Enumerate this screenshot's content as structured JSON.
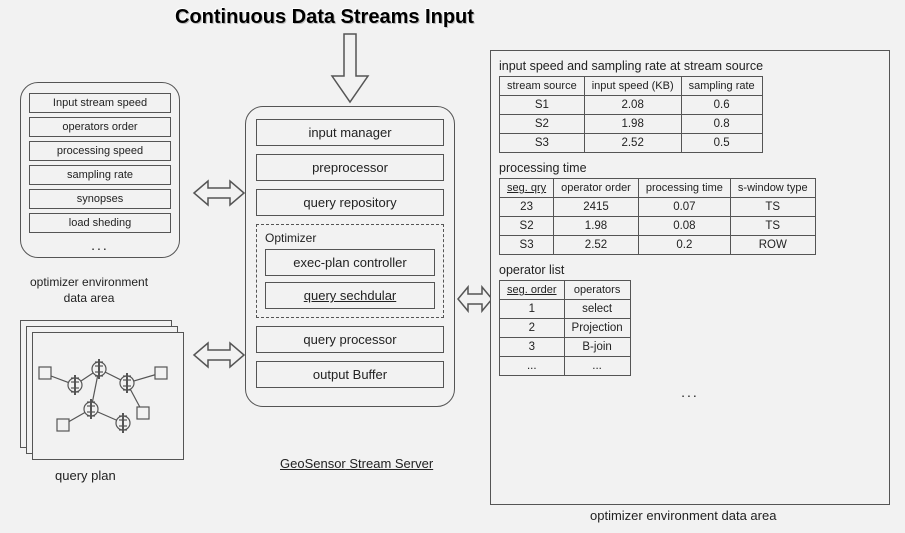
{
  "title": "Continuous Data Streams Input",
  "env_area": {
    "items": [
      "Input stream speed",
      "operators order",
      "processing speed",
      "sampling rate",
      "synopses",
      "load sheding"
    ],
    "dots": "...",
    "label_line1": "optimizer  environment",
    "label_line2": "data area"
  },
  "server": {
    "items_top": [
      "input manager",
      "preprocessor",
      "query repository"
    ],
    "optimizer_title": "Optimizer",
    "optimizer_items": [
      "exec-plan controller",
      "query sechdular"
    ],
    "items_bottom": [
      "query processor",
      "output Buffer"
    ],
    "label_prefix": "GeoSensor",
    "label_suffix": " Stream Server"
  },
  "query_plan_label": "query plan",
  "right": {
    "t1_title": "input speed and sampling rate at stream source",
    "t1_headers": [
      "stream source",
      "input speed (KB)",
      "sampling rate"
    ],
    "t1_rows": [
      [
        "S1",
        "2.08",
        "0.6"
      ],
      [
        "S2",
        "1.98",
        "0.8"
      ],
      [
        "S3",
        "2.52",
        "0.5"
      ]
    ],
    "t2_title": "processing time",
    "t2_headers": [
      "seg. qry",
      "operator order",
      "processing time",
      "s-window type"
    ],
    "t2_rows": [
      [
        "23",
        "2415",
        "0.07",
        "TS"
      ],
      [
        "S2",
        "1.98",
        "0.08",
        "TS"
      ],
      [
        "S3",
        "2.52",
        "0.2",
        "ROW"
      ]
    ],
    "t3_title": "operator list",
    "t3_headers": [
      "seg. order",
      "operators"
    ],
    "t3_rows": [
      [
        "1",
        "select"
      ],
      [
        "2",
        "Projection"
      ],
      [
        "3",
        "B-join"
      ],
      [
        "...",
        "..."
      ]
    ],
    "dots": "...",
    "label": "optimizer  environment data area"
  }
}
